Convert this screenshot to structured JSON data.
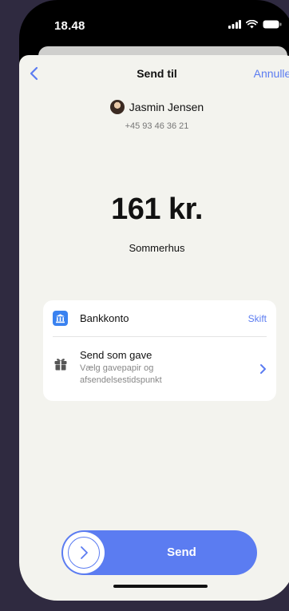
{
  "status_bar": {
    "time": "18.48",
    "icons": [
      "signal-icon",
      "wifi-icon",
      "battery-icon"
    ]
  },
  "nav": {
    "title": "Send til",
    "cancel_label": "Annuller",
    "back_icon": "chevron-left-icon"
  },
  "recipient": {
    "name": "Jasmin Jensen",
    "phone": "+45 93 46 36 21"
  },
  "payment": {
    "amount": "161 kr.",
    "message": "Sommerhus"
  },
  "options": {
    "bank": {
      "label": "Bankkonto",
      "action": "Skift",
      "icon": "bank-icon"
    },
    "gift": {
      "title": "Send som gave",
      "description": "Vælg gavepapir og afsendelsestidspunkt",
      "icon": "gift-icon"
    }
  },
  "send": {
    "label": "Send"
  },
  "colors": {
    "accent": "#5b7cf1",
    "background": "#f3f3ee",
    "outer": "#2f2a40"
  }
}
